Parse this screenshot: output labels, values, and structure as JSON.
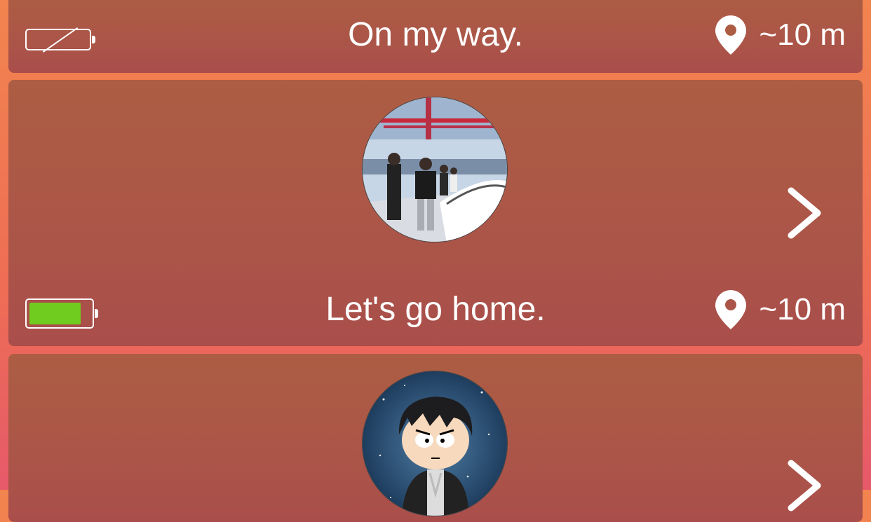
{
  "cards": [
    {
      "status": "On my way.",
      "distance": "~10 m",
      "battery_level": 0,
      "battery_icon": "battery-empty-icon"
    },
    {
      "status": "Let's go home.",
      "distance": "~10 m",
      "battery_level": 0.85,
      "battery_icon": "battery-full-icon",
      "avatar": "photo-people-on-boat-icon"
    },
    {
      "avatar": "cartoon-character-icon"
    }
  ],
  "colors": {
    "battery_green": "#70cc1e",
    "card_bg": "#ab5548",
    "background": "#ee6d55",
    "text": "#ffffff"
  }
}
